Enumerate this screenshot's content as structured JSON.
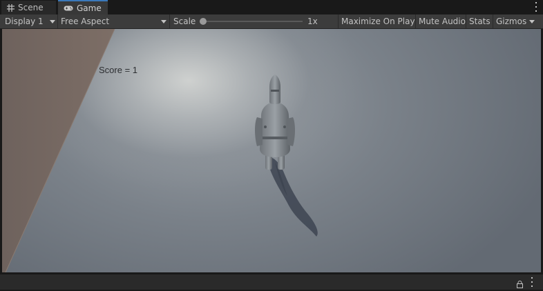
{
  "tabs": {
    "scene": {
      "label": "Scene",
      "icon": "grid-hash-icon"
    },
    "game": {
      "label": "Game",
      "icon": "gamepad-icon",
      "active": true
    }
  },
  "toolbar": {
    "display": "Display 1",
    "aspect": "Free Aspect",
    "scale_label": "Scale",
    "scale_value": "1x",
    "scale_level": 0.0,
    "maximize": "Maximize On Play",
    "mute": "Mute Audio",
    "stats": "Stats",
    "gizmos": "Gizmos"
  },
  "game": {
    "score_text": "Score = 1"
  },
  "colors": {
    "accent_tab": "#3a79bb",
    "wall": "#786860",
    "floor": "#6b727b"
  }
}
